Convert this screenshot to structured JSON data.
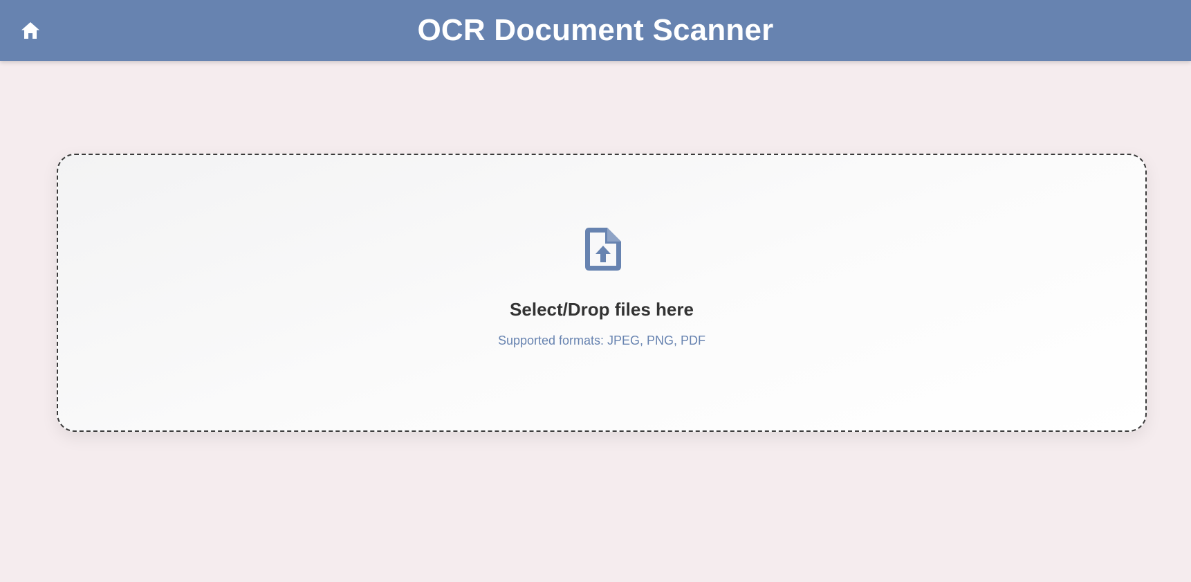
{
  "header": {
    "title": "OCR Document Scanner",
    "home_icon": "home-icon",
    "background_color": "#6783b0"
  },
  "dropzone": {
    "icon": "file-upload-icon",
    "icon_color": "#6783b0",
    "title": "Select/Drop files here",
    "subtitle": "Supported formats: JPEG, PNG, PDF"
  },
  "page": {
    "background_color": "#f5ecee"
  }
}
